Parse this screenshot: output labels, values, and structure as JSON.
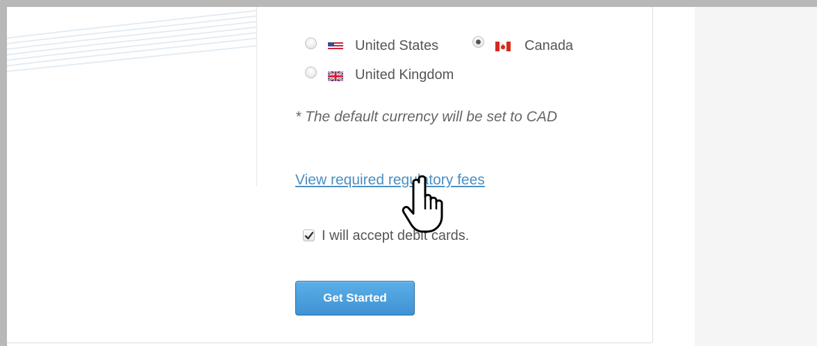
{
  "country": {
    "options": [
      {
        "label": "United States",
        "flag": "us-flag-icon",
        "checked": false
      },
      {
        "label": "Canada",
        "flag": "ca-flag-icon",
        "checked": true
      },
      {
        "label": "United Kingdom",
        "flag": "uk-flag-icon",
        "checked": false
      }
    ]
  },
  "currency_note": "* The default currency will be set to CAD",
  "regulatory_link": "View required regulatory fees",
  "debit": {
    "label": "I will accept debit cards.",
    "checked": true
  },
  "get_started_label": "Get Started",
  "colors": {
    "link": "#4a8ec2",
    "button": "#4a9fe0",
    "button_border": "#2b6a9f",
    "text": "#555555",
    "frame": "#b8b8b8"
  }
}
